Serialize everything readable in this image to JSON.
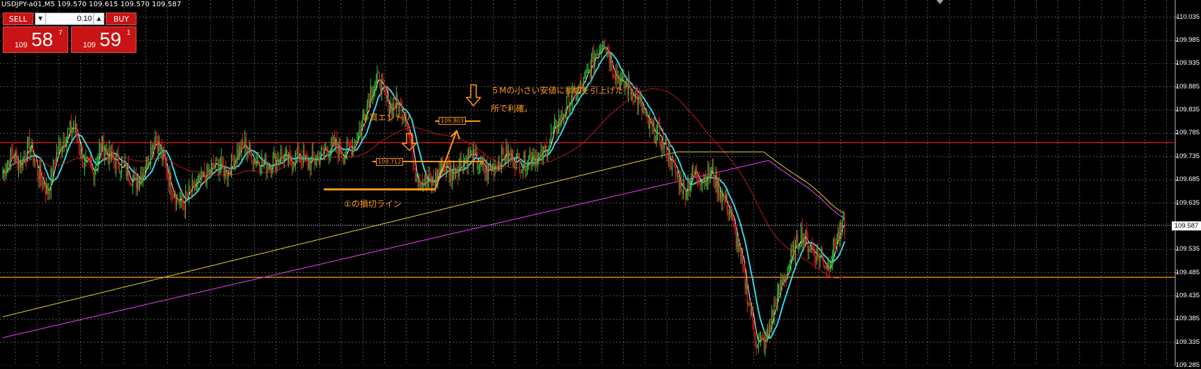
{
  "window": {
    "title": "USDJPY-a01,M5  109.570 109.615 109.570 109.587"
  },
  "trade_panel": {
    "sell_label": "SELL",
    "buy_label": "BUY",
    "lot_value": "0.10",
    "sell_price": {
      "prefix": "109",
      "big": "58",
      "sup": "7"
    },
    "buy_price": {
      "prefix": "109",
      "big": "59",
      "sup": "1"
    }
  },
  "annotations": {
    "entry_note": "①買エントリ",
    "stop_line_note": "①の損切ライン",
    "profit_note_line1": "５Mの小さい安値に損切を引上げた",
    "profit_note_line2": "所で利確。",
    "entry_price_box": "109.712",
    "stop_price_box": "109.803"
  },
  "price_axis": {
    "labels": [
      "110.035",
      "109.985",
      "109.935",
      "109.885",
      "109.835",
      "109.785",
      "109.735",
      "109.685",
      "109.635",
      "109.587",
      "109.535",
      "109.485",
      "109.435",
      "109.385",
      "109.335",
      "109.285"
    ],
    "current_price": "109.587"
  },
  "colors": {
    "background": "#000000",
    "grid": "#8a8a8a",
    "bull_candle": "#2ecc40",
    "bear_candle": "#e02020",
    "ma_fast": "#ffffff",
    "ma_mid": "#3ad6e6",
    "ma_slow_red": "#c01818",
    "ma_yellow": "#e6d62a",
    "ma_magenta": "#c83ad6",
    "horizontal_red": "#ff2020",
    "horizontal_orange": "#ff9a1a",
    "accent": "#ff9a1a"
  },
  "chart_data": {
    "type": "candlestick",
    "symbol": "USDJPY-a01",
    "timeframe": "M5",
    "ohlc": {
      "open": 109.57,
      "high": 109.615,
      "low": 109.57,
      "close": 109.587
    },
    "ylim": [
      109.285,
      110.045
    ],
    "horizontal_lines": [
      {
        "price": 109.765,
        "color": "red"
      },
      {
        "price": 109.475,
        "color": "orange"
      },
      {
        "price": 109.587,
        "color": "white-dotted"
      }
    ],
    "price_path": [
      109.7,
      109.74,
      109.72,
      109.76,
      109.7,
      109.66,
      109.74,
      109.78,
      109.8,
      109.72,
      109.7,
      109.76,
      109.73,
      109.72,
      109.7,
      109.68,
      109.72,
      109.78,
      109.72,
      109.66,
      109.63,
      109.66,
      109.68,
      109.7,
      109.72,
      109.7,
      109.74,
      109.76,
      109.73,
      109.72,
      109.72,
      109.74,
      109.72,
      109.74,
      109.72,
      109.73,
      109.75,
      109.76,
      109.74,
      109.76,
      109.8,
      109.88,
      109.9,
      109.84,
      109.85,
      109.82,
      109.7,
      109.68,
      109.68,
      109.72,
      109.7,
      109.72,
      109.74,
      109.72,
      109.7,
      109.72,
      109.74,
      109.73,
      109.72,
      109.74,
      109.73,
      109.77,
      109.81,
      109.85,
      109.87,
      109.9,
      109.95,
      109.99,
      109.93,
      109.89,
      109.88,
      109.85,
      109.8,
      109.78,
      109.75,
      109.7,
      109.66,
      109.7,
      109.69,
      109.7,
      109.66,
      109.62,
      109.54,
      109.44,
      109.34,
      109.33,
      109.41,
      109.47,
      109.52,
      109.57,
      109.54,
      109.52,
      109.5,
      109.56,
      109.59
    ]
  }
}
